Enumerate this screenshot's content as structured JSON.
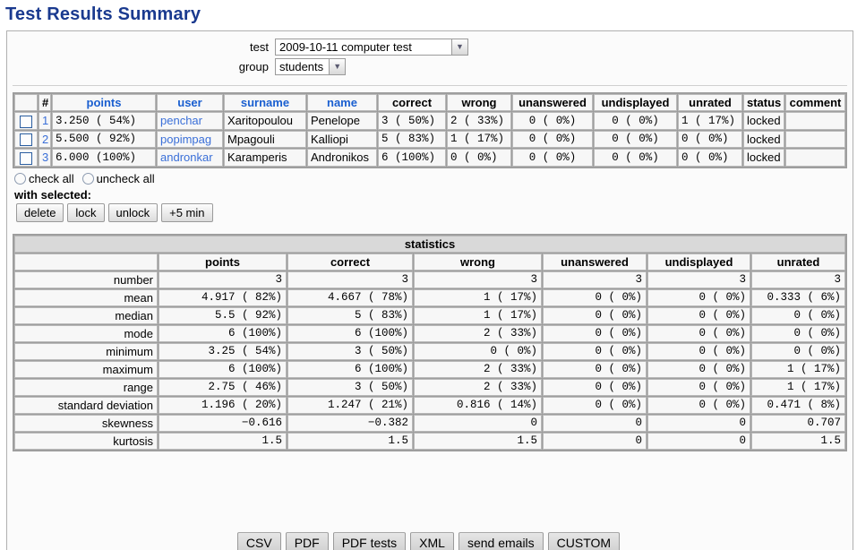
{
  "page": {
    "title": "Test Results Summary"
  },
  "selector": {
    "test_label": "test",
    "test_value": "2009-10-11 computer test",
    "group_label": "group",
    "group_value": "students"
  },
  "results_table": {
    "columns": [
      "",
      "#",
      "points",
      "user",
      "surname",
      "name",
      "correct",
      "wrong",
      "unanswered",
      "undisplayed",
      "unrated",
      "status",
      "comment"
    ],
    "rows": [
      {
        "index": "1",
        "points": "3.250 ( 54%)",
        "user": "penchar",
        "surname": "Xaritopoulou",
        "name": "Penelope",
        "correct": "3 ( 50%)",
        "wrong": "2 ( 33%)",
        "unanswered": "0 (  0%)",
        "undisplayed": "0 (  0%)",
        "unrated": "1 ( 17%)",
        "status": "locked",
        "comment": ""
      },
      {
        "index": "2",
        "points": "5.500 ( 92%)",
        "user": "popimpag",
        "surname": "Mpagouli",
        "name": "Kalliopi",
        "correct": "5 ( 83%)",
        "wrong": "1 ( 17%)",
        "unanswered": "0 (  0%)",
        "undisplayed": "0 (  0%)",
        "unrated": "0 (  0%)",
        "status": "locked",
        "comment": ""
      },
      {
        "index": "3",
        "points": "6.000 (100%)",
        "user": "andronkar",
        "surname": "Karamperis",
        "name": "Andronikos",
        "correct": "6 (100%)",
        "wrong": "0 (  0%)",
        "unanswered": "0 (  0%)",
        "undisplayed": "0 (  0%)",
        "unrated": "0 (  0%)",
        "status": "locked",
        "comment": ""
      }
    ]
  },
  "selection_controls": {
    "check_all": "check all",
    "uncheck_all": "uncheck all",
    "with_selected": "with selected:",
    "buttons": [
      "delete",
      "lock",
      "unlock",
      "+5 min"
    ]
  },
  "statistics": {
    "caption": "statistics",
    "columns": [
      "",
      "points",
      "correct",
      "wrong",
      "unanswered",
      "undisplayed",
      "unrated"
    ],
    "rows": [
      {
        "label": "number",
        "values": [
          "3",
          "3",
          "3",
          "3",
          "3",
          "3"
        ]
      },
      {
        "label": "mean",
        "values": [
          "4.917 ( 82%)",
          "4.667 ( 78%)",
          "1 ( 17%)",
          "0 (  0%)",
          "0 (  0%)",
          "0.333 (  6%)"
        ]
      },
      {
        "label": "median",
        "values": [
          "5.5 ( 92%)",
          "5 ( 83%)",
          "1 ( 17%)",
          "0 (  0%)",
          "0 (  0%)",
          "0 (  0%)"
        ]
      },
      {
        "label": "mode",
        "values": [
          "6 (100%)",
          "6 (100%)",
          "2 ( 33%)",
          "0 (  0%)",
          "0 (  0%)",
          "0 (  0%)"
        ]
      },
      {
        "label": "minimum",
        "values": [
          "3.25 ( 54%)",
          "3 ( 50%)",
          "0 (  0%)",
          "0 (  0%)",
          "0 (  0%)",
          "0 (  0%)"
        ]
      },
      {
        "label": "maximum",
        "values": [
          "6 (100%)",
          "6 (100%)",
          "2 ( 33%)",
          "0 (  0%)",
          "0 (  0%)",
          "1 ( 17%)"
        ]
      },
      {
        "label": "range",
        "values": [
          "2.75 ( 46%)",
          "3 ( 50%)",
          "2 ( 33%)",
          "0 (  0%)",
          "0 (  0%)",
          "1 ( 17%)"
        ]
      },
      {
        "label": "standard deviation",
        "values": [
          "1.196 ( 20%)",
          "1.247 ( 21%)",
          "0.816 ( 14%)",
          "0 (  0%)",
          "0 (  0%)",
          "0.471 (  8%)"
        ]
      },
      {
        "label": "skewness",
        "values": [
          "−0.616",
          "−0.382",
          "0",
          "0",
          "0",
          "0.707"
        ]
      },
      {
        "label": "kurtosis",
        "values": [
          "1.5",
          "1.5",
          "1.5",
          "0",
          "0",
          "1.5"
        ]
      }
    ]
  },
  "export_buttons": [
    "CSV",
    "PDF",
    "PDF tests",
    "XML",
    "send emails",
    "CUSTOM"
  ],
  "colors": {
    "title": "#1a3a8f",
    "link": "#1a5fd0",
    "locked_bg": "#ffb3b3",
    "caption_bg": "#d9d9d9"
  }
}
